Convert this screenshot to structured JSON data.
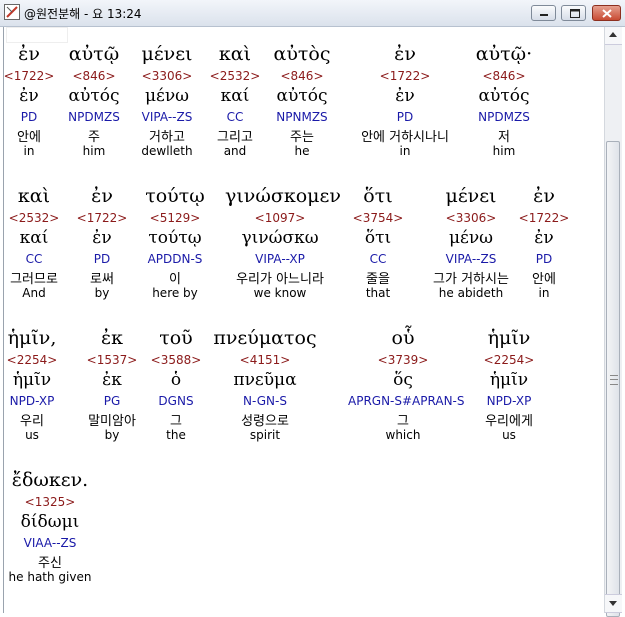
{
  "window": {
    "title": "@원전분해 - 요 13:24"
  },
  "rows": [
    {
      "words": [
        {
          "greek": "ἐν",
          "strong": "<1722>",
          "lemma": "ἐν",
          "parse": "PD",
          "korean": "안에",
          "english": "in"
        },
        {
          "greek": "αὐτῷ",
          "strong": "<846>",
          "lemma": "αὐτός",
          "parse": "NPDMZS",
          "korean": "주",
          "english": "him"
        },
        {
          "greek": "μένει",
          "strong": "<3306>",
          "lemma": "μένω",
          "parse": "VIPA--ZS",
          "korean": "거하고",
          "english": "dewlleth"
        },
        {
          "greek": "καὶ",
          "strong": "<2532>",
          "lemma": "καί",
          "parse": "CC",
          "korean": "그리고",
          "english": "and"
        },
        {
          "greek": "αὐτὸς",
          "strong": "<846>",
          "lemma": "αὐτός",
          "parse": "NPNMZS",
          "korean": "주는",
          "english": "he"
        },
        {
          "greek": "ἐν",
          "strong": "<1722>",
          "lemma": "ἐν",
          "parse": "PD",
          "korean": "안에 거하시나니",
          "english": "in"
        },
        {
          "greek": "αὐτῷ·",
          "strong": "<846>",
          "lemma": "αὐτός",
          "parse": "NPDMZS",
          "korean": "저",
          "english": "him"
        }
      ]
    },
    {
      "words": [
        {
          "greek": "καὶ",
          "strong": "<2532>",
          "lemma": "καί",
          "parse": "CC",
          "korean": "그러므로",
          "english": "And"
        },
        {
          "greek": "ἐν",
          "strong": "<1722>",
          "lemma": "ἐν",
          "parse": "PD",
          "korean": "로써",
          "english": "by"
        },
        {
          "greek": "τούτῳ",
          "strong": "<5129>",
          "lemma": "τούτῳ",
          "parse": "APDDN-S",
          "korean": "이",
          "english": "here by"
        },
        {
          "greek": "γινώσκομεν",
          "strong": "<1097>",
          "lemma": "γινώσκω",
          "parse": "VIPA--XP",
          "korean": "우리가 아느니라",
          "english": "we know"
        },
        {
          "greek": "ὅτι",
          "strong": "<3754>",
          "lemma": "ὅτι",
          "parse": "CC",
          "korean": "줄을",
          "english": "that"
        },
        {
          "greek": "μένει",
          "strong": "<3306>",
          "lemma": "μένω",
          "parse": "VIPA--ZS",
          "korean": "그가 거하시는",
          "english": "he abideth"
        },
        {
          "greek": "ἐν",
          "strong": "<1722>",
          "lemma": "ἐν",
          "parse": "PD",
          "korean": "안에",
          "english": "in"
        }
      ]
    },
    {
      "words": [
        {
          "greek": "ἡμῖν,",
          "strong": "<2254>",
          "lemma": "ἡμῖν",
          "parse": "NPD-XP",
          "korean": "우리",
          "english": "us"
        },
        {
          "greek": "ἐκ",
          "strong": "<1537>",
          "lemma": "ἐκ",
          "parse": "PG",
          "korean": "말미암아",
          "english": "by"
        },
        {
          "greek": "τοῦ",
          "strong": "<3588>",
          "lemma": "ὁ",
          "parse": "DGNS",
          "korean": "그",
          "english": "the"
        },
        {
          "greek": "πνεύματος",
          "strong": "<4151>",
          "lemma": "πνεῦμα",
          "parse": "N-GN-S",
          "korean": "성령으로",
          "english": "spirit"
        },
        {
          "greek": "οὗ",
          "strong": "<3739>",
          "lemma": "ὅς",
          "parse": "APRGN-S#APRAN-S",
          "korean": "그",
          "english": "which"
        },
        {
          "greek": "ἡμῖν",
          "strong": "<2254>",
          "lemma": "ἡμῖν",
          "parse": "NPD-XP",
          "korean": "우리에게",
          "english": "us"
        }
      ]
    },
    {
      "words": [
        {
          "greek": "ἔδωκεν.",
          "strong": "<1325>",
          "lemma": "δίδωμι",
          "parse": "VIAA--ZS",
          "korean": "주신",
          "english": "he hath given"
        }
      ]
    }
  ]
}
